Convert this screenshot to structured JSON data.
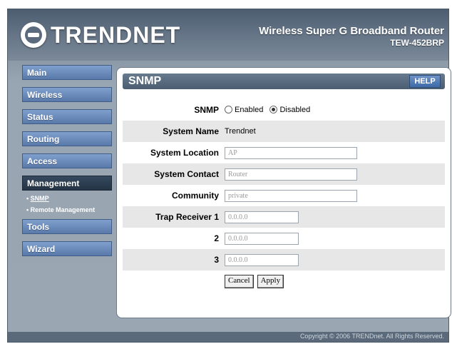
{
  "brand": {
    "logo_text": "TRENDNET"
  },
  "product": {
    "title": "Wireless Super G Broadband Router",
    "model": "TEW-452BRP"
  },
  "nav": {
    "items": [
      {
        "label": "Main"
      },
      {
        "label": "Wireless"
      },
      {
        "label": "Status"
      },
      {
        "label": "Routing"
      },
      {
        "label": "Access"
      },
      {
        "label": "Management"
      },
      {
        "label": "Tools"
      },
      {
        "label": "Wizard"
      }
    ],
    "sub": [
      {
        "label": "SNMP"
      },
      {
        "label": "Remote Management"
      }
    ]
  },
  "panel": {
    "title": "SNMP",
    "help": "HELP"
  },
  "form": {
    "snmp": {
      "label": "SNMP",
      "enabled": "Enabled",
      "disabled": "Disabled",
      "selected": "Disabled"
    },
    "system_name": {
      "label": "System Name",
      "value": "Trendnet"
    },
    "system_location": {
      "label": "System Location",
      "value": "AP"
    },
    "system_contact": {
      "label": "System Contact",
      "value": "Router"
    },
    "community": {
      "label": "Community",
      "value": "private"
    },
    "trap1": {
      "label": "Trap Receiver 1",
      "value": "0.0.0.0"
    },
    "trap2": {
      "label": "2",
      "value": "0.0.0.0"
    },
    "trap3": {
      "label": "3",
      "value": "0.0.0.0"
    },
    "cancel": "Cancel",
    "apply": "Apply"
  },
  "footer": {
    "copyright": "Copyright © 2006 TRENDnet. All Rights Reserved."
  }
}
